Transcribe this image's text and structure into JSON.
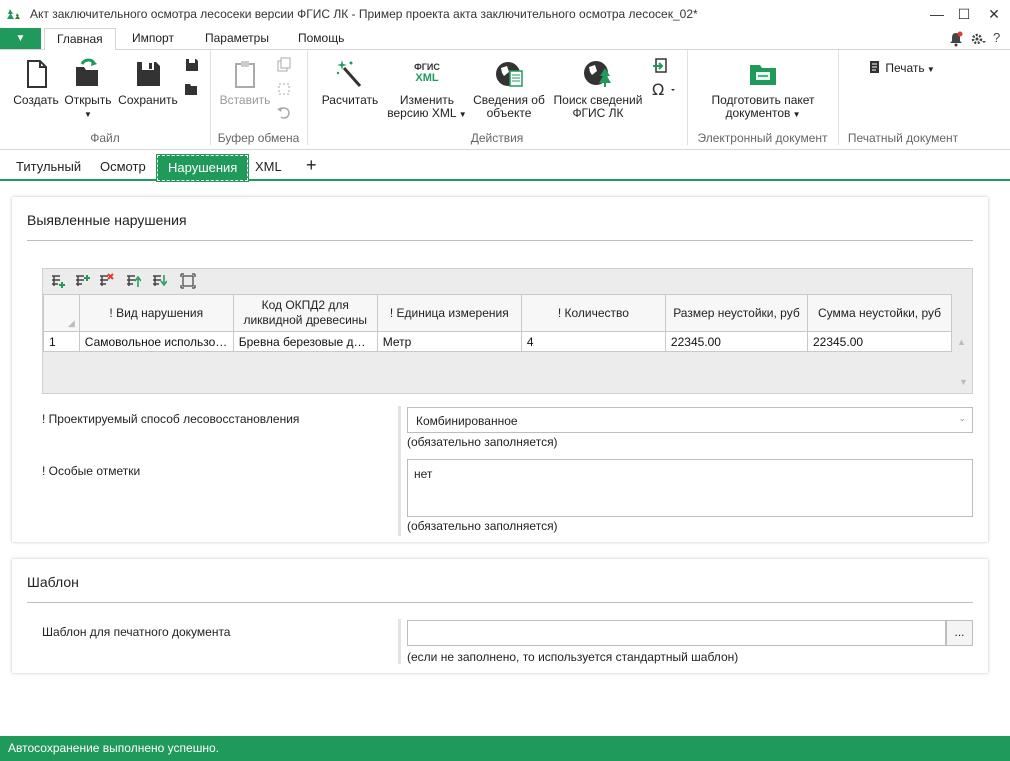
{
  "window": {
    "title": "Акт заключительного осмотра лесосеки версии ФГИС ЛК - Пример проекта акта заключительного осмотра лесосек_02*",
    "minimize": "—",
    "maximize": "☐",
    "close": "✕"
  },
  "menu": {
    "file_arrow": "▼",
    "tabs": [
      "Главная",
      "Импорт",
      "Параметры",
      "Помощь"
    ],
    "help": "?"
  },
  "ribbon": {
    "file_group": {
      "create": "Создать",
      "open": "Открыть",
      "save": "Сохранить",
      "label": "Файл"
    },
    "clipboard_group": {
      "paste": "Вставить",
      "label": "Буфер обмена"
    },
    "actions_group": {
      "calculate": "Расчитать",
      "change_xml_1": "Изменить",
      "change_xml_2": "версию XML",
      "xml_badge_top": "ФГИС",
      "xml_badge_bottom": "XML",
      "object_info_1": "Сведения об",
      "object_info_2": "объекте",
      "search_1": "Поиск сведений",
      "search_2": "ФГИС ЛК",
      "label": "Действия"
    },
    "edoc_group": {
      "prepare_1": "Подготовить пакет",
      "prepare_2": "документов",
      "label": "Электронный документ"
    },
    "print_group": {
      "print": "Печать",
      "label": "Печатный документ"
    }
  },
  "doc_tabs": [
    "Титульный",
    "Осмотр",
    "Нарушения",
    "XML",
    "+"
  ],
  "violations": {
    "title": "Выявленные нарушения",
    "columns": [
      "! Вид нарушения",
      "Код ОКПД2 для ликвидной древесины",
      "! Единица измерения",
      "! Количество",
      "Размер неустойки, руб",
      "Сумма неустойки, руб"
    ],
    "rows": [
      {
        "num": "1",
        "cells": [
          "Самовольное использо…",
          "Бревна березовые для…",
          "Метр",
          "4",
          "22345.00",
          "22345.00"
        ]
      }
    ],
    "method_label": "! Проектируемый способ лесовосстановления",
    "method_value": "Комбинированное",
    "method_note": "(обязательно заполняется)",
    "notes_label": "! Особые отметки",
    "notes_value": "нет",
    "notes_note": "(обязательно заполняется)"
  },
  "template": {
    "title": "Шаблон",
    "label": "Шаблон для печатного документа",
    "value": "",
    "button": "...",
    "note": "(если не заполнено, то используется стандартный шаблон)"
  },
  "status": "Автосохранение выполнено успешно.",
  "colors": {
    "accent": "#1f9a5b"
  }
}
